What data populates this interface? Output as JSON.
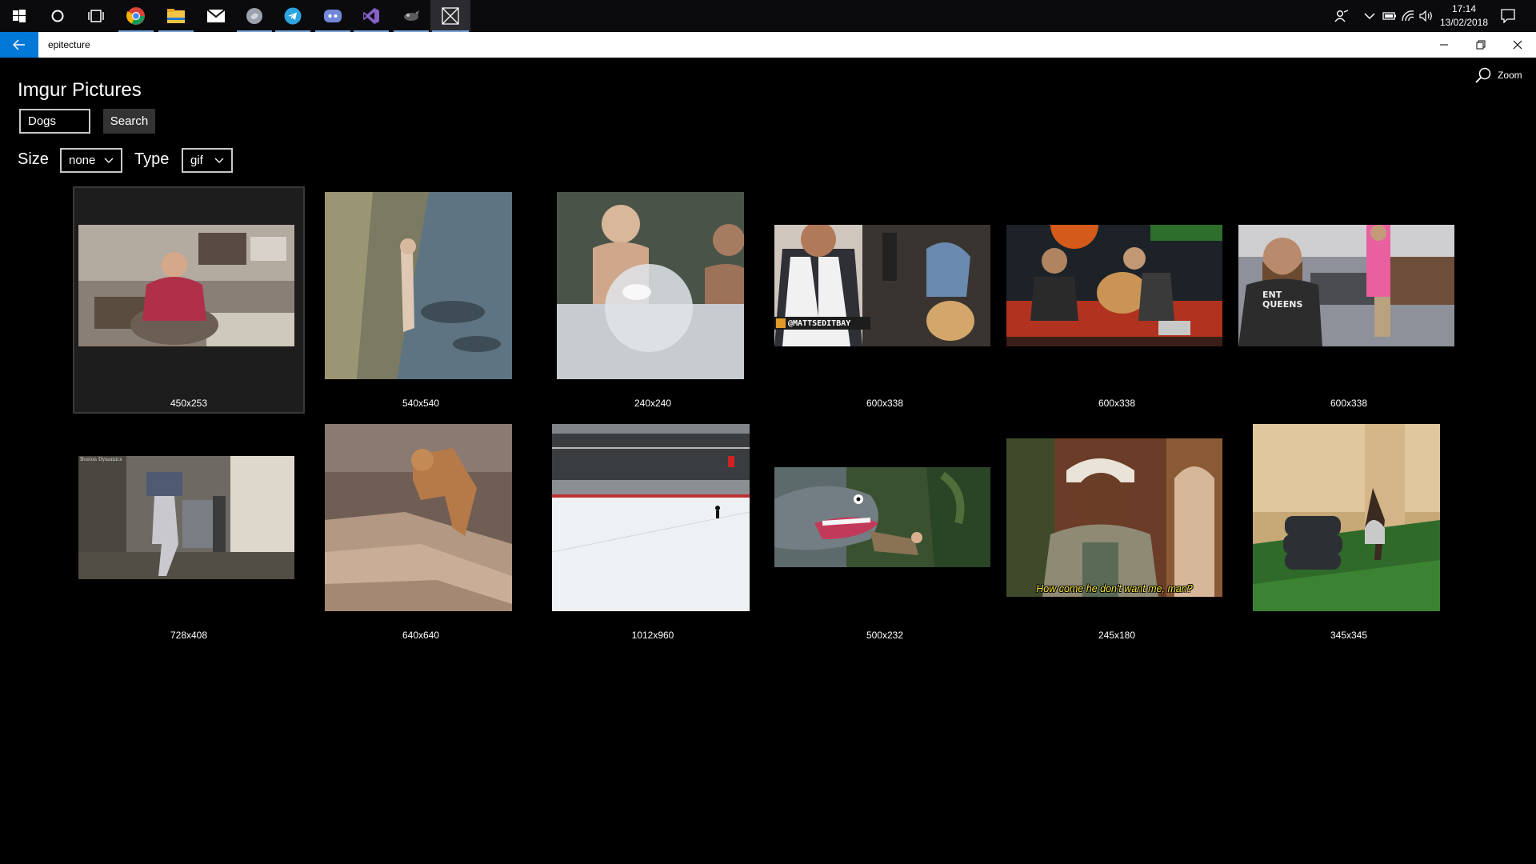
{
  "taskbar": {
    "apps": [
      "start-icon",
      "cortana-icon",
      "task-view-icon",
      "chrome-icon",
      "file-explorer-icon",
      "mail-icon",
      "app-icon",
      "telegram-icon",
      "discord-icon",
      "visual-studio-icon",
      "app-icon-2",
      "epitecture-icon"
    ],
    "clock_time": "17:14",
    "clock_date": "13/02/2018"
  },
  "titlebar": {
    "title": "epitecture",
    "accent": "#0078d7"
  },
  "main": {
    "page_title": "Imgur Pictures",
    "search_value": "Dogs",
    "search_button": "Search",
    "size_label": "Size",
    "size_value": "none",
    "type_label": "Type",
    "type_value": "gif",
    "zoom_label": "Zoom"
  },
  "images": [
    {
      "label": "450x253",
      "description": "man in red shirt at restaurant table"
    },
    {
      "label": "540x540",
      "description": "child at water edge with fish"
    },
    {
      "label": "240x240",
      "description": "kids with water balloon"
    },
    {
      "label": "600x338",
      "caption": "@MATTSEDITBAY"
    },
    {
      "label": "600x338",
      "description": "dog on sofa with men"
    },
    {
      "label": "600x338",
      "caption": "ENT QUEENS"
    },
    {
      "label": "728x408",
      "caption": "Boston Dynamics"
    },
    {
      "label": "640x640",
      "description": "fox on rocks"
    },
    {
      "label": "1012x960",
      "description": "ice rink"
    },
    {
      "label": "500x232",
      "description": "cartoon creature"
    },
    {
      "label": "245x180",
      "caption": "How come he don't want me, man?"
    },
    {
      "label": "345x345",
      "description": "person flipping on tires"
    }
  ]
}
